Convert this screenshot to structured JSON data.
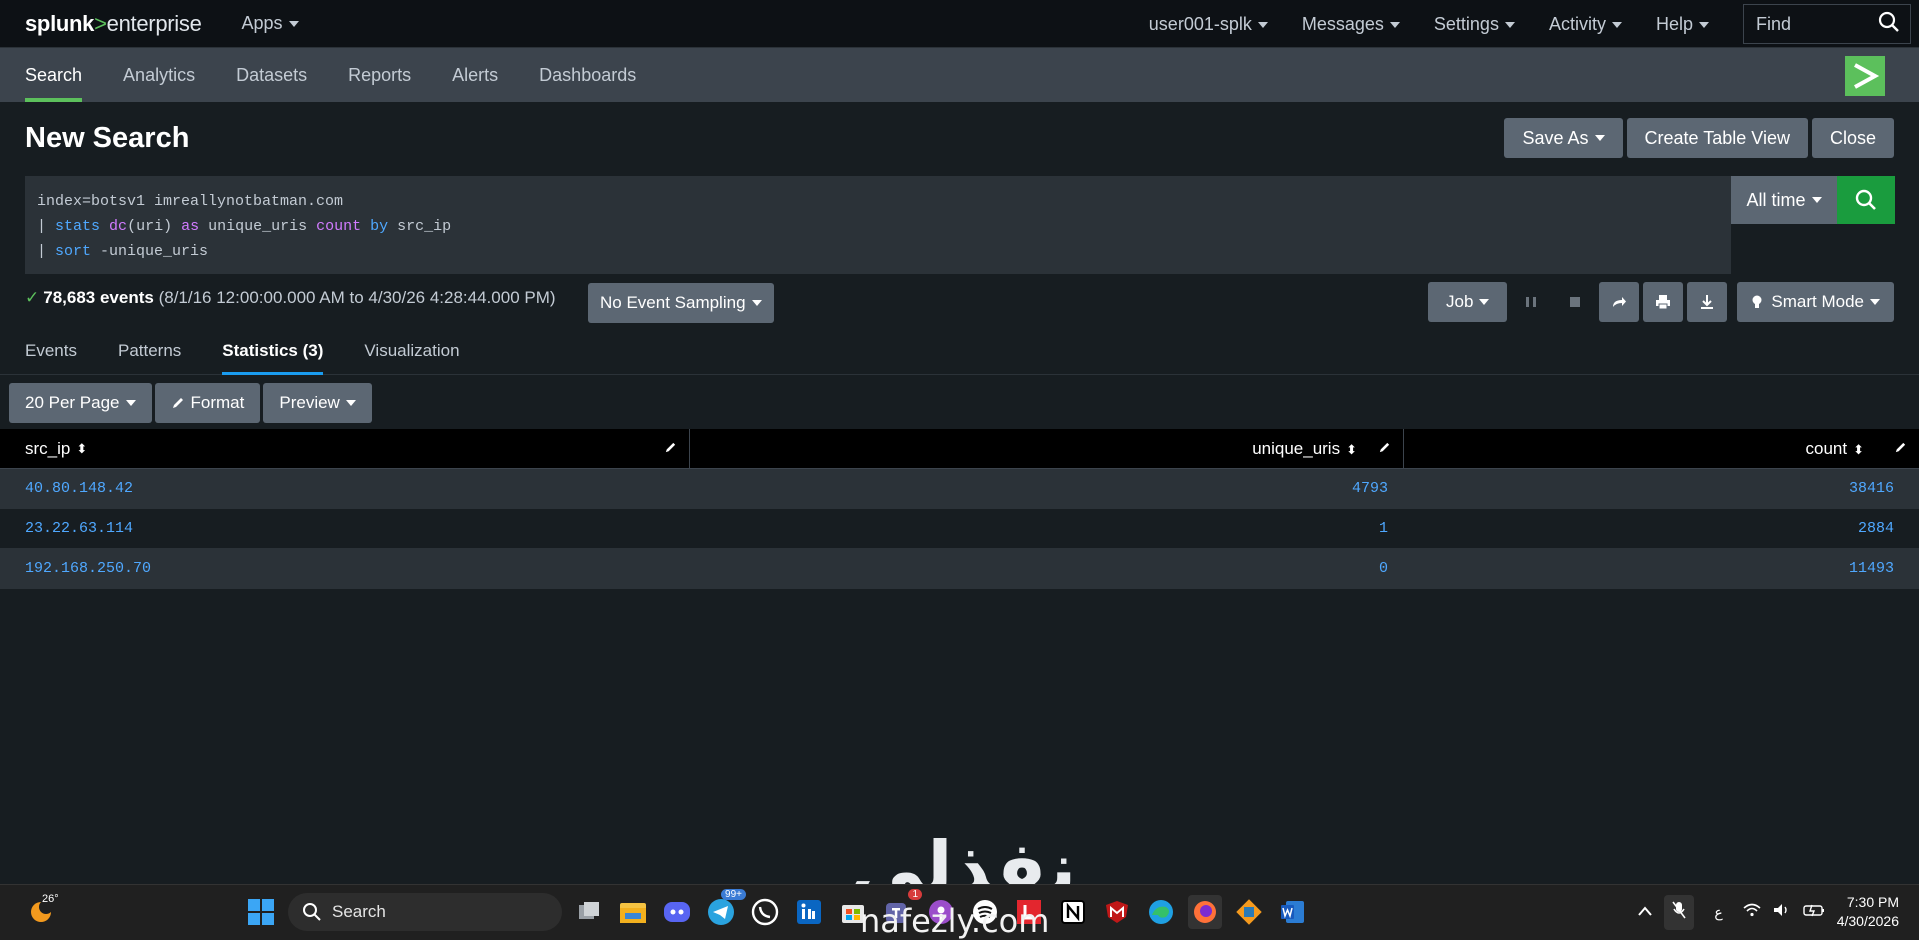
{
  "topbar": {
    "logo_brand": "splunk",
    "logo_sep": ">",
    "logo_product": "enterprise",
    "apps": "Apps",
    "menus": [
      "user001-splk",
      "Messages",
      "Settings",
      "Activity",
      "Help"
    ],
    "find_placeholder": "Find"
  },
  "appnav": {
    "items": [
      "Search",
      "Analytics",
      "Datasets",
      "Reports",
      "Alerts",
      "Dashboards"
    ],
    "active": "Search"
  },
  "page": {
    "title": "New Search",
    "buttons": {
      "save_as": "Save As",
      "create_table_view": "Create Table View",
      "close": "Close"
    }
  },
  "search": {
    "line1": "index=botsv1 imreallynotbatman.com",
    "line2_pipe": "| ",
    "line2_kw1": "stats",
    "line2_fn": "dc",
    "line2_arg": "(uri) ",
    "line2_kw2": "as",
    "line2_field": " unique_uris ",
    "line2_kw3": "count",
    "line2_sp": " ",
    "line2_kw4": "by",
    "line2_end": " src_ip",
    "line3_pipe": "| ",
    "line3_kw": "sort",
    "line3_end": " -unique_uris",
    "time_range": "All time"
  },
  "status": {
    "check": "✓",
    "count": "78,683 events",
    "range": "(8/1/16 12:00:00.000 AM to 4/30/26 4:28:44.000 PM)",
    "sampling": "No Event Sampling",
    "job": "Job",
    "mode": "Smart Mode"
  },
  "tabs": [
    "Events",
    "Patterns",
    "Statistics (3)",
    "Visualization"
  ],
  "toolbar": {
    "per_page": "20 Per Page",
    "format": "Format",
    "preview": "Preview"
  },
  "table": {
    "columns": [
      "src_ip",
      "unique_uris",
      "count"
    ],
    "rows": [
      [
        "40.80.148.42",
        "4793",
        "38416"
      ],
      [
        "23.22.63.114",
        "1",
        "2884"
      ],
      [
        "192.168.250.70",
        "0",
        "11493"
      ]
    ]
  },
  "watermark": {
    "arabic": "نفذلي",
    "latin": "nafezly.com"
  },
  "taskbar": {
    "temp": "26°",
    "search": "Search",
    "badge_telegram": "99+",
    "badge_teams": "1",
    "lang": "ع",
    "time": "7:30 PM",
    "date": "4/30/2026"
  },
  "colors": {
    "accent_green": "#5cc05c",
    "link_blue": "#4fa8ff",
    "search_green": "#1a9c3e",
    "tab_underline": "#1a9cf0"
  }
}
